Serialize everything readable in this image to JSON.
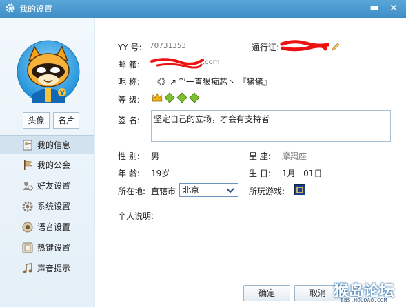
{
  "window": {
    "title": "我的设置",
    "minimize_glyph": "▬",
    "close_glyph": "✕"
  },
  "sidebar": {
    "avatar_button": "头像",
    "card_button": "名片",
    "items": [
      {
        "label": "我的信息",
        "icon": "id-card-icon",
        "active": true
      },
      {
        "label": "我的公会",
        "icon": "flag-icon"
      },
      {
        "label": "好友设置",
        "icon": "friend-gear-icon"
      },
      {
        "label": "系统设置",
        "icon": "gear-icon"
      },
      {
        "label": "语音设置",
        "icon": "speaker-icon"
      },
      {
        "label": "热键设置",
        "icon": "keyboard-icon"
      },
      {
        "label": "声音提示",
        "icon": "music-note-icon"
      }
    ]
  },
  "profile": {
    "yy_label": "YY 号:",
    "yy_value": "70731353",
    "passport_label": "通行证:",
    "email_label": "邮  箱:",
    "email_suffix": ".com",
    "nickname_label": "昵  称:",
    "nickname_value": "《》↗ ‴’一直狠痴芯丶   『猪猪』",
    "level_label": "等  级:",
    "signature_label": "签  名:",
    "signature_value": "坚定自己的立场，才会有支持者",
    "gender_label": "性  别:",
    "gender_value": "男",
    "zodiac_label": "星  座:",
    "zodiac_value": "摩羯座",
    "age_label": "年  龄:",
    "age_value": "19岁",
    "birthday_label": "生  日:",
    "birthday_value": "1月   01日",
    "location_label": "所在地:",
    "location_province": "直辖市",
    "location_city": "北京",
    "games_label": "所玩游戏:",
    "bio_label": "个人说明:"
  },
  "buttons": {
    "ok": "确定",
    "cancel": "取消"
  },
  "watermark": {
    "text": "猴岛论坛",
    "url": "BBS.HOUDAO.COM"
  },
  "colors": {
    "titlebar": "#4a9ad0",
    "redaction": "#ee1111",
    "accent": "#6b95bf"
  }
}
